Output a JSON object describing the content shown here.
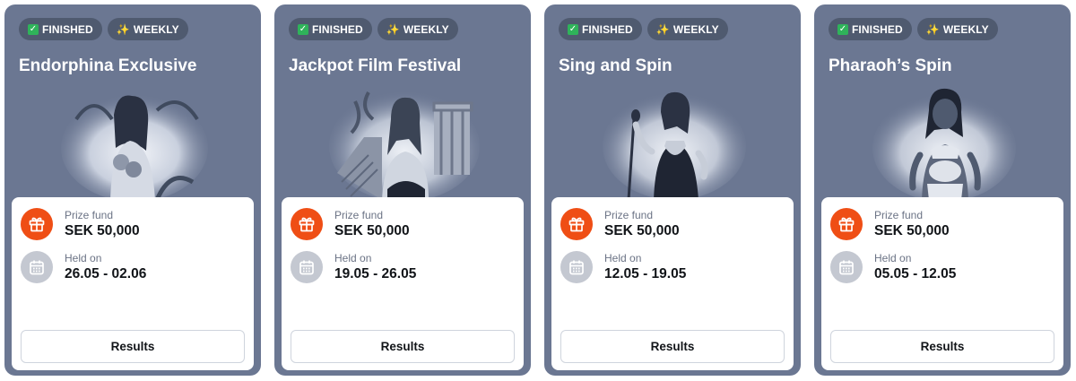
{
  "cards": [
    {
      "status_label": "FINISHED",
      "period_label": "WEEKLY",
      "title": "Endorphina Exclusive",
      "prize_label": "Prize fund",
      "prize_value": "SEK 50,000",
      "held_label": "Held on",
      "held_value": "26.05 - 02.06",
      "button_label": "Results"
    },
    {
      "status_label": "FINISHED",
      "period_label": "WEEKLY",
      "title": "Jackpot Film Festival",
      "prize_label": "Prize fund",
      "prize_value": "SEK 50,000",
      "held_label": "Held on",
      "held_value": "19.05 - 26.05",
      "button_label": "Results"
    },
    {
      "status_label": "FINISHED",
      "period_label": "WEEKLY",
      "title": "Sing and Spin",
      "prize_label": "Prize fund",
      "prize_value": "SEK 50,000",
      "held_label": "Held on",
      "held_value": "12.05 - 19.05",
      "button_label": "Results"
    },
    {
      "status_label": "FINISHED",
      "period_label": "WEEKLY",
      "title": "Pharaoh’s Spin",
      "prize_label": "Prize fund",
      "prize_value": "SEK 50,000",
      "held_label": "Held on",
      "held_value": "05.05 - 12.05",
      "button_label": "Results"
    }
  ],
  "icons": {
    "status": "check-icon",
    "period": "sparkles-icon",
    "prize": "gift-icon",
    "held": "calendar-icon"
  },
  "colors": {
    "card_background": "#6b7792",
    "badge_background": "#4f5a6f",
    "prize_icon_background": "#ef4e15",
    "held_icon_background": "#c4c8d1"
  }
}
